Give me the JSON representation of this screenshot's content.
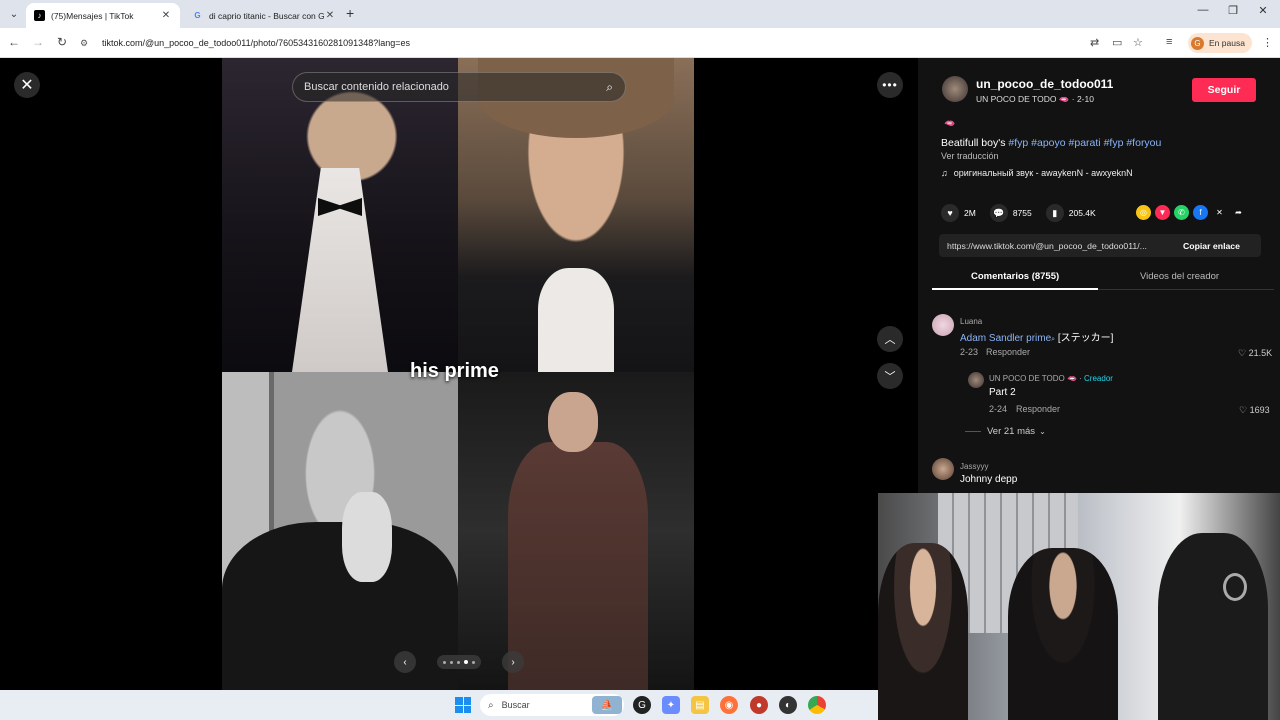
{
  "browser": {
    "tabs": [
      {
        "title": "(75)Mensajes | TikTok",
        "active": true
      },
      {
        "title": "di caprio titanic - Buscar con Go",
        "active": false
      }
    ],
    "url": "tiktok.com/@un_pocoo_de_todoo011/photo/7605343160281091348?lang=es",
    "profile_status": "En pausa",
    "profile_initial": "G"
  },
  "viewer": {
    "search_placeholder": "Buscar contenido relacionado",
    "overlay_caption": "his prime",
    "pager_active_index": 3,
    "pager_total": 5
  },
  "post": {
    "username": "un_pocoo_de_todoo011",
    "display_sub": "UN POCO DE TODO 🫦 · 2-10",
    "follow_label": "Seguir",
    "emoji_line": "🫦",
    "description_prefix": "Beatifull boy's ",
    "hashtags": [
      "#fyp",
      "#apoyo",
      "#parati",
      "#fyp",
      "#foryou"
    ],
    "translate_label": "Ver traducción",
    "music": "оригинальный звук - awaykenN - awxyeknN",
    "likes": "2M",
    "comments": "8755",
    "saves": "205.4K",
    "link": "https://www.tiktok.com/@un_pocoo_de_todoo011/...",
    "copy_label": "Copiar enlace"
  },
  "tabs2": {
    "comments_tab": "Comentarios (8755)",
    "creator_tab": "Videos del creador"
  },
  "comments": [
    {
      "user": "Luana",
      "text": "Adam Sandler prime",
      "text_suffix": " [ステッカー]",
      "date": "2-23",
      "reply": "Responder",
      "likes": "21.5K"
    },
    {
      "user": "UN POCO DE TODO 🫦 ·",
      "badge": "Creador",
      "text": "Part 2",
      "date": "2-24",
      "reply": "Responder",
      "likes": "1693"
    },
    {
      "more": "Ver 21 más"
    },
    {
      "user": "Jassyyy",
      "text": "Johnny depp"
    }
  ],
  "taskbar": {
    "search_label": "Buscar"
  },
  "colors": {
    "accent": "#fe2c55",
    "hashtag": "#8ab4f8",
    "creator_badge": "#20d5ec"
  }
}
